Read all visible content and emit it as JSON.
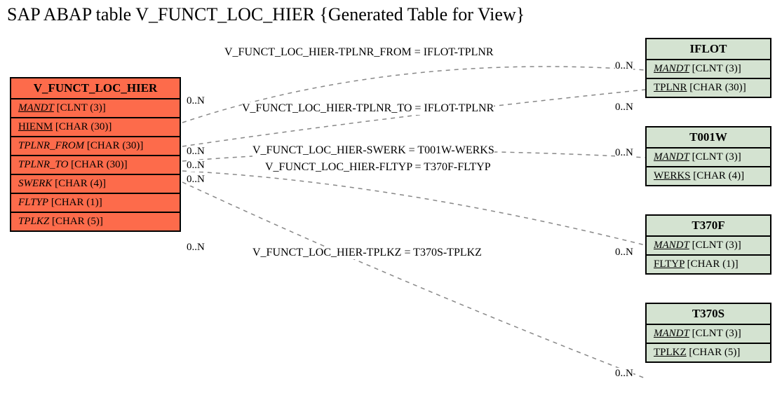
{
  "title": "SAP ABAP table V_FUNCT_LOC_HIER {Generated Table for View}",
  "main_table": {
    "name": "V_FUNCT_LOC_HIER",
    "fields": [
      {
        "name": "MANDT",
        "type": "CLNT (3)",
        "key": true
      },
      {
        "name": "HIENM",
        "type": "CHAR (30)",
        "key": false,
        "ul": true
      },
      {
        "name": "TPLNR_FROM",
        "type": "CHAR (30)",
        "key": false,
        "it": true
      },
      {
        "name": "TPLNR_TO",
        "type": "CHAR (30)",
        "key": false,
        "it": true
      },
      {
        "name": "SWERK",
        "type": "CHAR (4)",
        "key": false,
        "it": true
      },
      {
        "name": "FLTYP",
        "type": "CHAR (1)",
        "key": false,
        "it": true
      },
      {
        "name": "TPLKZ",
        "type": "CHAR (5)",
        "key": false,
        "it": true
      }
    ]
  },
  "ref_tables": [
    {
      "name": "IFLOT",
      "fields": [
        {
          "name": "MANDT",
          "type": "CLNT (3)",
          "key": true
        },
        {
          "name": "TPLNR",
          "type": "CHAR (30)",
          "key": false,
          "ul": true
        }
      ]
    },
    {
      "name": "T001W",
      "fields": [
        {
          "name": "MANDT",
          "type": "CLNT (3)",
          "key": true
        },
        {
          "name": "WERKS",
          "type": "CHAR (4)",
          "key": false,
          "ul": true
        }
      ]
    },
    {
      "name": "T370F",
      "fields": [
        {
          "name": "MANDT",
          "type": "CLNT (3)",
          "key": true
        },
        {
          "name": "FLTYP",
          "type": "CHAR (1)",
          "key": false,
          "ul": true
        }
      ]
    },
    {
      "name": "T370S",
      "fields": [
        {
          "name": "MANDT",
          "type": "CLNT (3)",
          "key": true
        },
        {
          "name": "TPLKZ",
          "type": "CHAR (5)",
          "key": false,
          "ul": true
        }
      ]
    }
  ],
  "relations": [
    {
      "label": "V_FUNCT_LOC_HIER-TPLNR_FROM = IFLOT-TPLNR",
      "left": "0..N",
      "right": "0..N"
    },
    {
      "label": "V_FUNCT_LOC_HIER-TPLNR_TO = IFLOT-TPLNR",
      "left": "0..N",
      "right": "0..N"
    },
    {
      "label": "V_FUNCT_LOC_HIER-SWERK = T001W-WERKS",
      "left": "0..N",
      "right": "0..N"
    },
    {
      "label": "V_FUNCT_LOC_HIER-FLTYP = T370F-FLTYP",
      "left": "0..N",
      "right": ""
    },
    {
      "label": "V_FUNCT_LOC_HIER-TPLKZ = T370S-TPLKZ",
      "left": "0..N",
      "right": "0..N"
    }
  ],
  "extra_card_right_t370s": "0..N"
}
